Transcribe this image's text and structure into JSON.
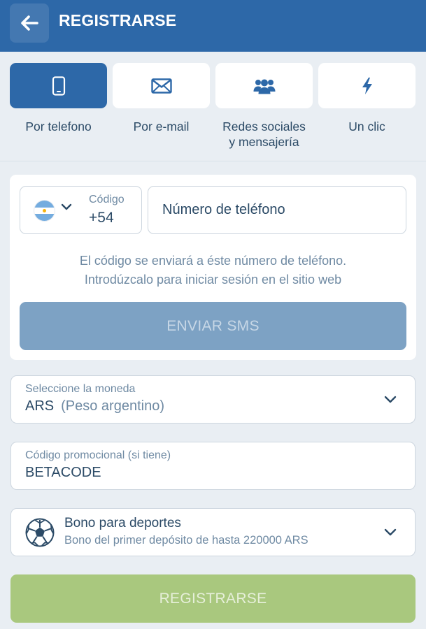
{
  "header": {
    "title": "REGISTRARSE"
  },
  "tabs": [
    {
      "label": "Por telefono",
      "icon": "phone-icon",
      "active": true
    },
    {
      "label": "Por e-mail",
      "icon": "envelope-icon",
      "active": false
    },
    {
      "label_line1": "Redes sociales",
      "label_line2": "y mensajería",
      "icon": "people-icon",
      "active": false
    },
    {
      "label": "Un clic",
      "icon": "lightning-icon",
      "active": false
    }
  ],
  "phone_form": {
    "code_label": "Código",
    "code_value": "+54",
    "phone_placeholder": "Número de teléfono",
    "info_line1": "El código se enviará a éste número de teléfono.",
    "info_line2": "Introdúzcalo para iniciar sesión en el sitio web",
    "sms_button": "ENVIAR SMS"
  },
  "currency": {
    "label": "Seleccione la moneda",
    "code": "ARS",
    "name": "(Peso argentino)"
  },
  "promo": {
    "label": "Código promocional (si tiene)",
    "value": "BETACODE"
  },
  "bonus": {
    "title": "Bono para deportes",
    "subtitle": "Bono del primer depósito de hasta 220000 ARS"
  },
  "register_button": "REGISTRARSE",
  "colors": {
    "primary": "#2d68a8",
    "text": "#2b4a66",
    "muted": "#6f8aa3",
    "sms_disabled": "#7da2c4",
    "register_disabled": "#a9c87e"
  }
}
